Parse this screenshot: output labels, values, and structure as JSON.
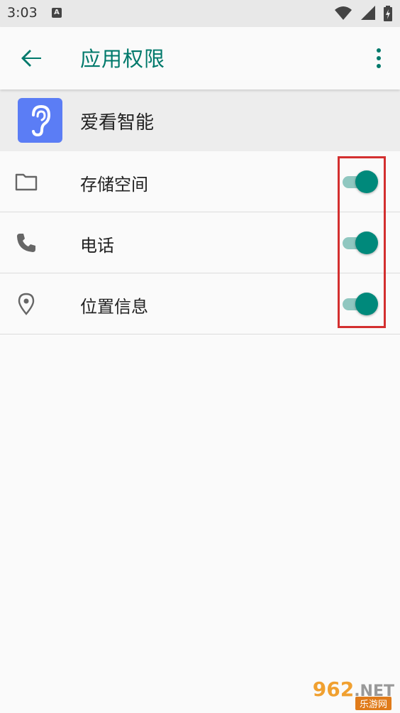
{
  "status_bar": {
    "time": "3:03",
    "notification_icon": "A"
  },
  "app_bar": {
    "title": "应用权限",
    "back_icon": "arrow-left-icon",
    "more_icon": "more-vert-icon",
    "accent_color": "#00796b"
  },
  "app": {
    "name": "爱看智能",
    "icon": "ear-icon",
    "icon_bg": "#5b7df5"
  },
  "permissions": [
    {
      "label": "存储空间",
      "icon": "folder-icon",
      "enabled": true
    },
    {
      "label": "电话",
      "icon": "phone-icon",
      "enabled": true
    },
    {
      "label": "位置信息",
      "icon": "location-pin-icon",
      "enabled": true
    }
  ],
  "toggle_color": "#00897b",
  "watermark": {
    "main": "962",
    "suffix": ".NET",
    "sub": "乐游网"
  }
}
